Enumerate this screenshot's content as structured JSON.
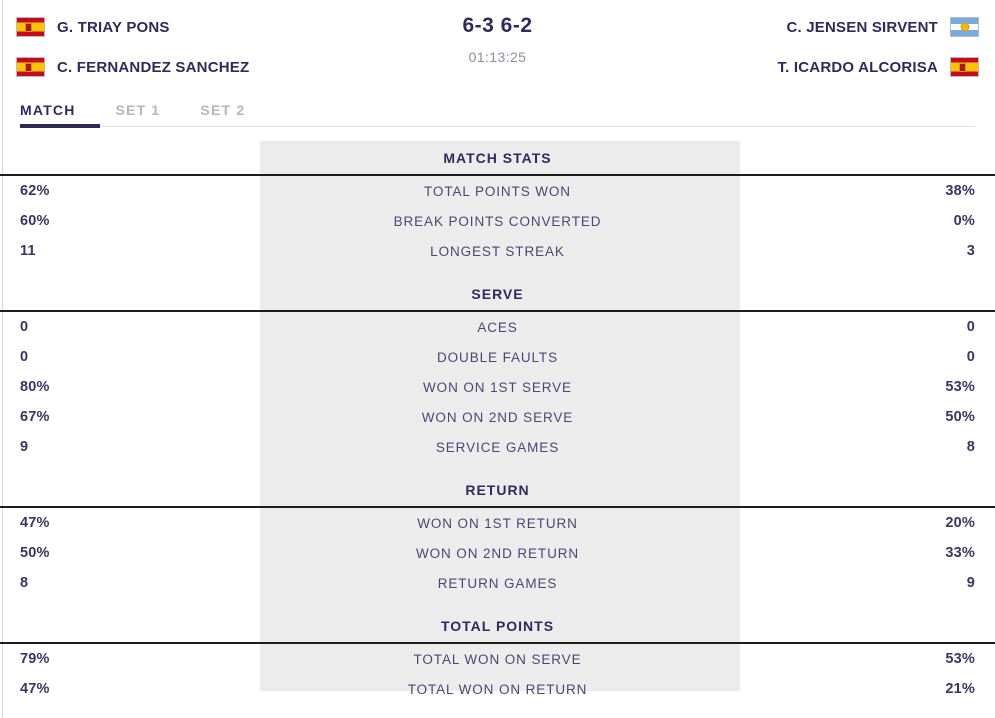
{
  "scoreboard": {
    "home": {
      "players": [
        {
          "name": "G. TRIAY PONS",
          "flag": "spain-flag-icon"
        },
        {
          "name": "C. FERNANDEZ SANCHEZ",
          "flag": "spain-flag-icon"
        }
      ]
    },
    "away": {
      "players": [
        {
          "name": "C. JENSEN SIRVENT",
          "flag": "argentina-flag-icon"
        },
        {
          "name": "T. ICARDO ALCORISA",
          "flag": "spain-flag-icon"
        }
      ]
    },
    "score": "6-3 6-2",
    "duration": "01:13:25"
  },
  "tabs": [
    {
      "label": "MATCH",
      "active": true
    },
    {
      "label": "SET 1",
      "active": false
    },
    {
      "label": "SET 2",
      "active": false
    }
  ],
  "stats": {
    "sections": [
      {
        "title": "MATCH STATS",
        "rows": [
          {
            "left": "62%",
            "label": "TOTAL POINTS WON",
            "right": "38%"
          },
          {
            "left": "60%",
            "label": "BREAK POINTS CONVERTED",
            "right": "0%"
          },
          {
            "left": "11",
            "label": "LONGEST STREAK",
            "right": "3"
          }
        ]
      },
      {
        "title": "SERVE",
        "rows": [
          {
            "left": "0",
            "label": "ACES",
            "right": "0"
          },
          {
            "left": "0",
            "label": "DOUBLE FAULTS",
            "right": "0"
          },
          {
            "left": "80%",
            "label": "WON ON 1ST SERVE",
            "right": "53%"
          },
          {
            "left": "67%",
            "label": "WON ON 2ND SERVE",
            "right": "50%"
          },
          {
            "left": "9",
            "label": "SERVICE GAMES",
            "right": "8"
          }
        ]
      },
      {
        "title": "RETURN",
        "rows": [
          {
            "left": "47%",
            "label": "WON ON 1ST RETURN",
            "right": "20%"
          },
          {
            "left": "50%",
            "label": "WON ON 2ND RETURN",
            "right": "33%"
          },
          {
            "left": "8",
            "label": "RETURN GAMES",
            "right": "9"
          }
        ]
      },
      {
        "title": "TOTAL POINTS",
        "rows": [
          {
            "left": "79%",
            "label": "TOTAL WON ON SERVE",
            "right": "53%"
          },
          {
            "left": "47%",
            "label": "TOTAL WON ON RETURN",
            "right": "21%"
          }
        ]
      }
    ]
  },
  "colors": {
    "navy": "#2e2b5c",
    "text": "#3a3663",
    "band": "#ececec",
    "muted": "#b6b6be",
    "rule": "#1c1c1c"
  }
}
